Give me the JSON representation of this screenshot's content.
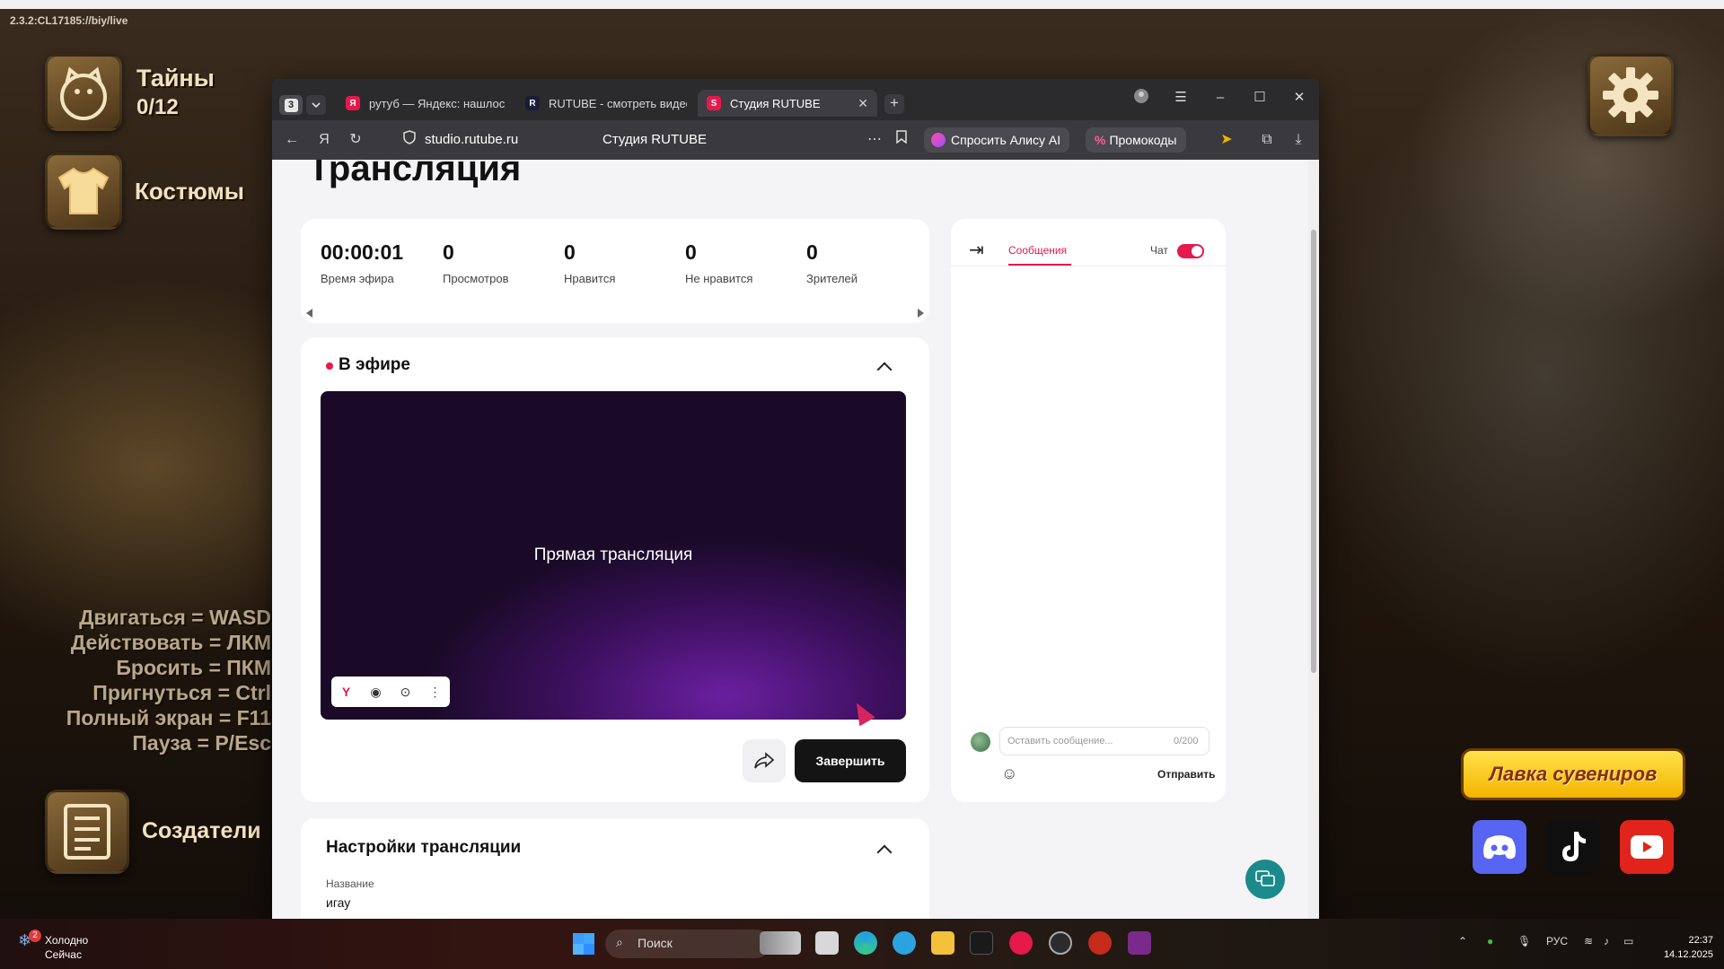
{
  "game": {
    "build_label": "2.3.2:CL17185://biy/live",
    "secrets": {
      "title": "Тайны",
      "count": "0/12"
    },
    "costumes": {
      "title": "Костюмы"
    },
    "credits": {
      "title": "Создатели"
    },
    "controls": [
      "Двигаться = WASD",
      "Действовать = ЛКМ",
      "Бросить = ПКМ",
      "Пригнуться = Ctrl",
      "Полный экран = F11",
      "Пауза = P/Esc"
    ],
    "souvenir_shop": "Лавка сувениров"
  },
  "browser": {
    "tab_count": "3",
    "tabs": [
      {
        "label": "рутуб — Яндекс: нашлос",
        "favicon": "yandex-icon",
        "favicon_color": "#e5194c"
      },
      {
        "label": "RUTUBE - смотреть видео",
        "favicon": "rutube-icon",
        "favicon_color": "#1b1b3a"
      },
      {
        "label": "Студия RUTUBE",
        "favicon": "rutube-studio-icon",
        "favicon_color": "#e5194c"
      }
    ],
    "url": "studio.rutube.ru",
    "page_title": "Студия RUTUBE",
    "alice_button": "Спросить Алису AI",
    "promo_button": "Промокоды"
  },
  "studio": {
    "heading": "Трансляция",
    "stats": [
      {
        "value": "00:00:01",
        "label": "Время эфира"
      },
      {
        "value": "0",
        "label": "Просмотров"
      },
      {
        "value": "0",
        "label": "Нравится"
      },
      {
        "value": "0",
        "label": "Не нравится"
      },
      {
        "value": "0",
        "label": "Зрителей"
      }
    ],
    "live_title": "В эфире",
    "video_label": "Прямая трансляция",
    "finish_button": "Завершить",
    "settings_title": "Настройки трансляции",
    "name_label": "Название",
    "name_value": "игау",
    "chat": {
      "tab_messages": "Сообщения",
      "toggle_label": "Чат",
      "input_placeholder": "Оставить сообщение...",
      "counter": "0/200",
      "send_button": "Отправить"
    }
  },
  "taskbar": {
    "weather_badge": "2",
    "weather_line1": "Холодно",
    "weather_line2": "Сейчас",
    "search_label": "Поиск",
    "language": "РУС",
    "time": "22:37",
    "date": "14.12.2025"
  },
  "colors": {
    "accent": "#e5194c",
    "souvenir": "#f3b400"
  }
}
